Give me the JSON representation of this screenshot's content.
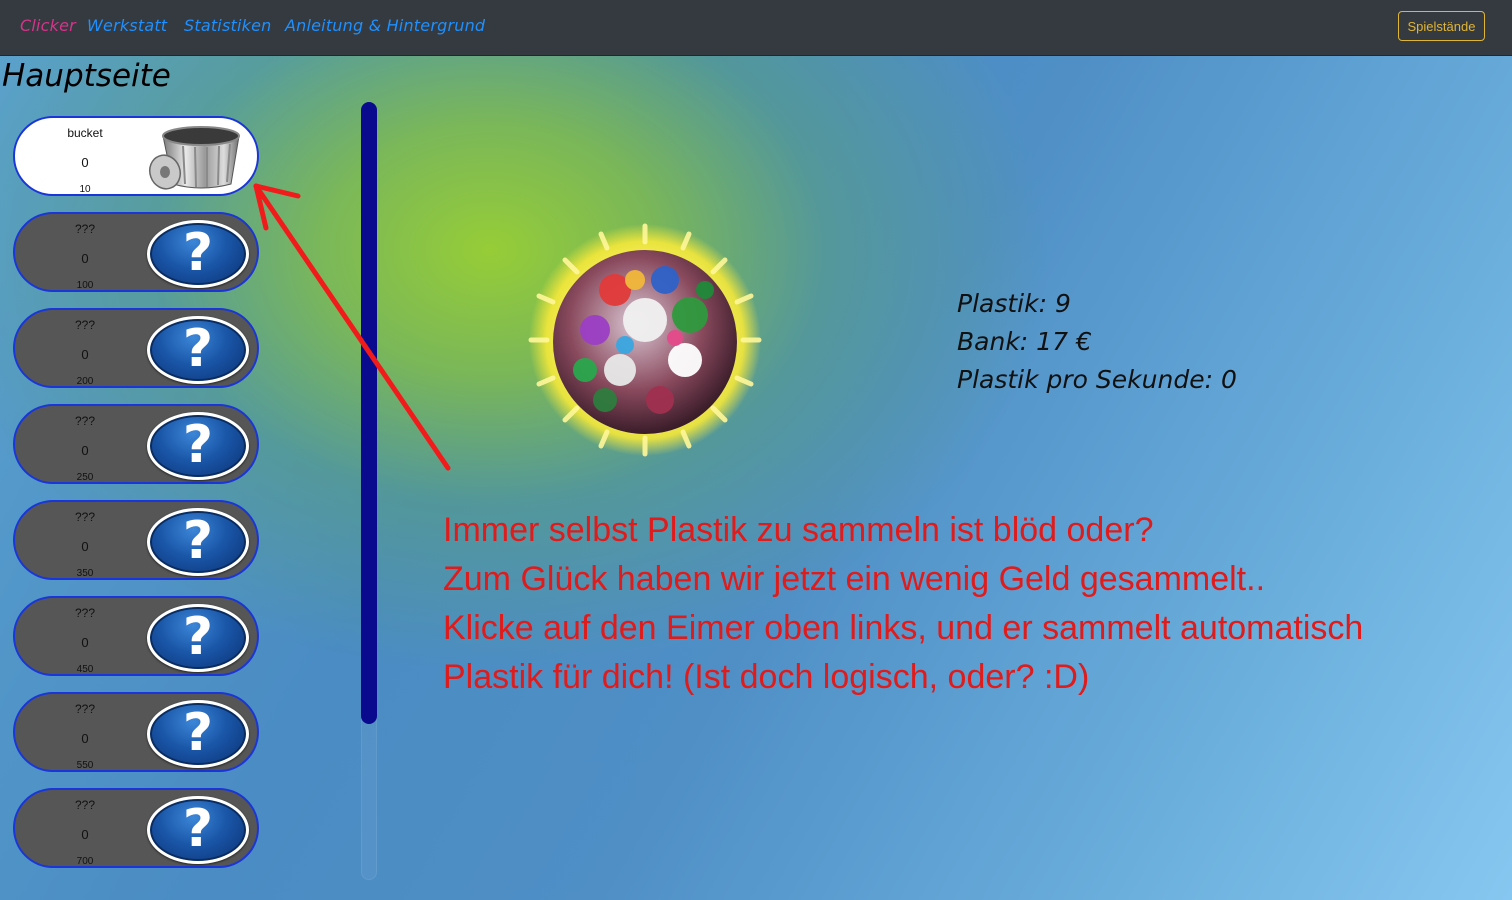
{
  "nav": {
    "links": [
      {
        "label": "Clicker",
        "active": true
      },
      {
        "label": "Werkstatt"
      },
      {
        "label": "Statistiken"
      },
      {
        "label": "Anleitung & Hintergrund"
      }
    ],
    "save_button": "Spielstände"
  },
  "page_title": "Hauptseite",
  "upgrades": [
    {
      "name": "bucket",
      "count": "0",
      "cost": "10",
      "icon": "bucket-icon"
    },
    {
      "name": "???",
      "count": "0",
      "cost": "100",
      "icon": "question-mark-icon"
    },
    {
      "name": "???",
      "count": "0",
      "cost": "200",
      "icon": "question-mark-icon"
    },
    {
      "name": "???",
      "count": "0",
      "cost": "250",
      "icon": "question-mark-icon"
    },
    {
      "name": "???",
      "count": "0",
      "cost": "350",
      "icon": "question-mark-icon"
    },
    {
      "name": "???",
      "count": "0",
      "cost": "450",
      "icon": "question-mark-icon"
    },
    {
      "name": "???",
      "count": "0",
      "cost": "550",
      "icon": "question-mark-icon"
    },
    {
      "name": "???",
      "count": "0",
      "cost": "700",
      "icon": "question-mark-icon"
    }
  ],
  "stats": {
    "plastik": "Plastik: 9",
    "bank": "Bank: 17 €",
    "per_second": "Plastik pro Sekunde: 0"
  },
  "tutorial": [
    "Immer selbst Plastik zu sammeln ist blöd oder?",
    "Zum Glück haben wir jetzt ein wenig Geld gesammelt..",
    "Klicke auf den Eimer oben links, und er sammelt automatisch",
    "Plastik für dich! (Ist doch logisch, oder? :D)"
  ],
  "colors": {
    "navbar": "#343a40",
    "active_link": "#d6338a",
    "link": "#1e90ff",
    "save_button": "#e0b534",
    "tutorial_text": "#e01b1b",
    "scroll_thumb": "#0a0a8f"
  }
}
